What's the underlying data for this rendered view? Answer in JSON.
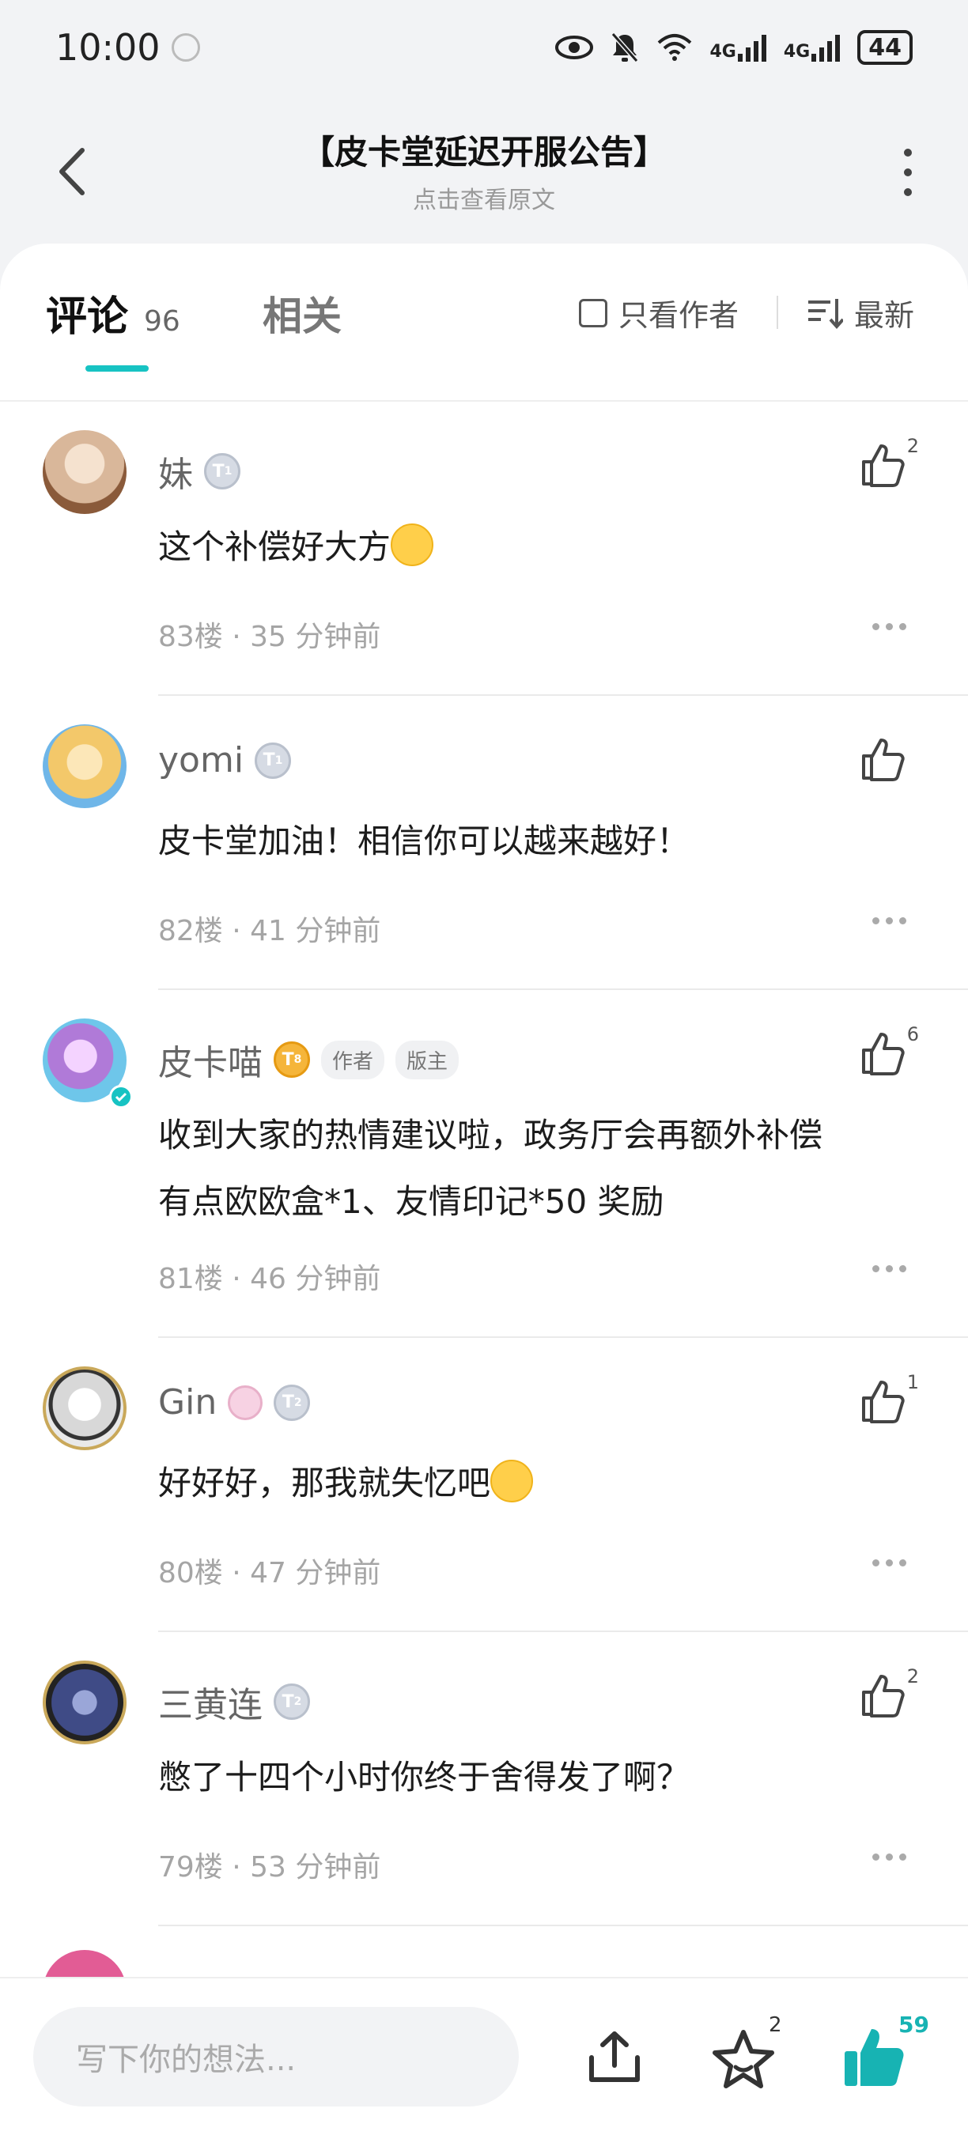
{
  "status_bar": {
    "time": "10:00",
    "network_1": "4G",
    "network_2": "4G",
    "battery": "44"
  },
  "header": {
    "title": "【皮卡堂延迟开服公告】",
    "subtitle": "点击查看原文"
  },
  "tabs": {
    "comments_label": "评论",
    "comments_count": "96",
    "related_label": "相关",
    "author_only_label": "只看作者",
    "sort_label": "最新"
  },
  "comments": [
    {
      "name": "妹",
      "level": "1",
      "text": "这个补偿好大方",
      "floor_time": "83楼 · 35 分钟前",
      "likes": "2",
      "avatar_color": "#d9b79a"
    },
    {
      "name": "yomi",
      "level": "1",
      "text": "皮卡堂加油！相信你可以越来越好！",
      "floor_time": "82楼 · 41 分钟前",
      "likes": "",
      "avatar_color": "#f3c86a"
    },
    {
      "name": "皮卡喵",
      "level": "8",
      "tags": [
        "作者",
        "版主"
      ],
      "text_line1": "收到大家的热情建议啦，政务厅会再额外补偿",
      "text_line2": "有点欧欧盒*1、友情印记*50 奖励",
      "floor_time": "81楼 · 46 分钟前",
      "likes": "6",
      "avatar_color": "#6ec6ea"
    },
    {
      "name": "Gin",
      "level": "2",
      "text": "好好好，那我就失忆吧",
      "floor_time": "80楼 · 47 分钟前",
      "likes": "1",
      "avatar_color": "#e9e9e9"
    },
    {
      "name": "三黄连",
      "level": "2",
      "text": "憋了十四个小时你终于舍得发了啊？",
      "floor_time": "79楼 · 53 分钟前",
      "likes": "2",
      "avatar_color": "#3f4b86"
    }
  ],
  "bottom_bar": {
    "input_placeholder": "写下你的想法...",
    "favorites_count": "2",
    "likes_count": "59"
  },
  "colors": {
    "accent": "#17c3c3",
    "gold_badge": "#f5b53a"
  }
}
